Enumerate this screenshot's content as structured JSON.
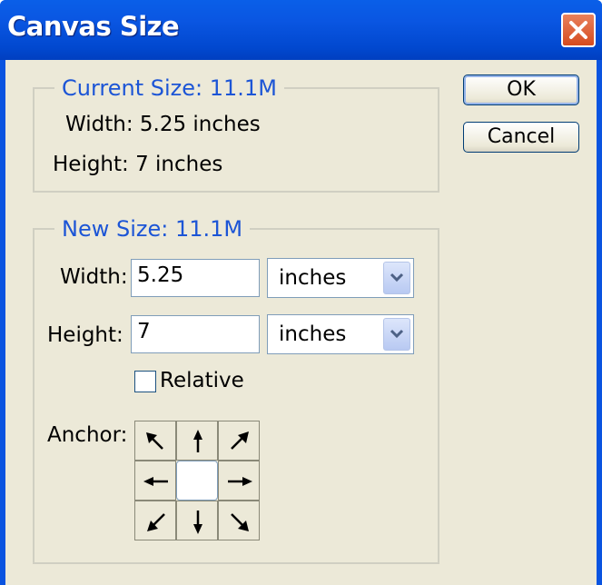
{
  "window": {
    "title": "Canvas Size"
  },
  "current_size": {
    "legend": "Current Size:  11.1M",
    "width_text": "Width: 5.25 inches",
    "height_text": "Height: 7 inches"
  },
  "new_size": {
    "legend": "New Size:  11.1M",
    "width_label": "Width:",
    "width_value": "5.25",
    "width_unit": "inches",
    "height_label": "Height:",
    "height_value": "7",
    "height_unit": "inches",
    "relative_label": "Relative",
    "relative_checked": false,
    "anchor_label": "Anchor:",
    "anchor_selected": "center"
  },
  "buttons": {
    "ok": "OK",
    "cancel": "Cancel"
  },
  "colors": {
    "title_bar": "#0a54e0",
    "legend_text": "#1c55d6",
    "dialog_bg": "#ece9d8",
    "close_button": "#d64b1f"
  },
  "icons": [
    "close-icon",
    "dropdown-arrow-icon",
    "arrow-nw-icon",
    "arrow-n-icon",
    "arrow-ne-icon",
    "arrow-w-icon",
    "arrow-e-icon",
    "arrow-sw-icon",
    "arrow-s-icon",
    "arrow-se-icon"
  ]
}
